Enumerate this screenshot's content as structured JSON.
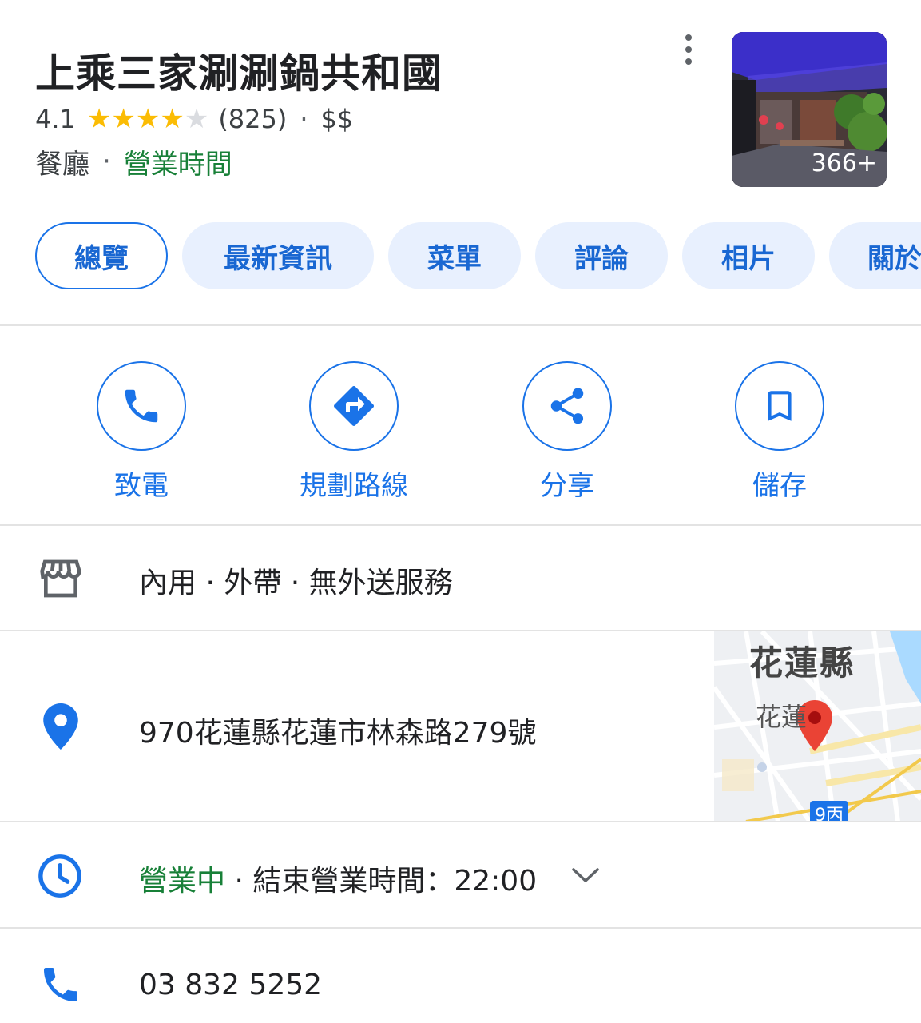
{
  "place": {
    "name": "上乘三家涮涮鍋共和國",
    "rating": "4.1",
    "rating_stars": 4.1,
    "review_count": "(825)",
    "separator": "·",
    "price": "$$",
    "category": "餐廳",
    "hours_link": "營業時間",
    "photo_count": "366+"
  },
  "tabs": [
    {
      "label": "總覽",
      "active": true
    },
    {
      "label": "最新資訊",
      "active": false
    },
    {
      "label": "菜單",
      "active": false
    },
    {
      "label": "評論",
      "active": false
    },
    {
      "label": "相片",
      "active": false
    },
    {
      "label": "關於",
      "active": false
    }
  ],
  "actions": {
    "call": {
      "label": "致電",
      "icon": "phone-icon"
    },
    "directions": {
      "label": "規劃路線",
      "icon": "directions-icon"
    },
    "share": {
      "label": "分享",
      "icon": "share-icon"
    },
    "save": {
      "label": "儲存",
      "icon": "bookmark-icon"
    }
  },
  "info": {
    "service_options": "內用 · 外帶 · 無外送服務",
    "address": "970花蓮縣花蓮市林森路279號",
    "hours_status": "營業中",
    "hours_detail": " · 結束營業時間：22:00",
    "phone": "03 832 5252"
  },
  "map": {
    "county_label": "花蓮縣",
    "city_label": "花蓮",
    "road_label": "9丙"
  },
  "colors": {
    "accent": "#1a73e8",
    "open_green": "#188038",
    "star": "#fbbc04",
    "pin_red": "#ea4335"
  }
}
